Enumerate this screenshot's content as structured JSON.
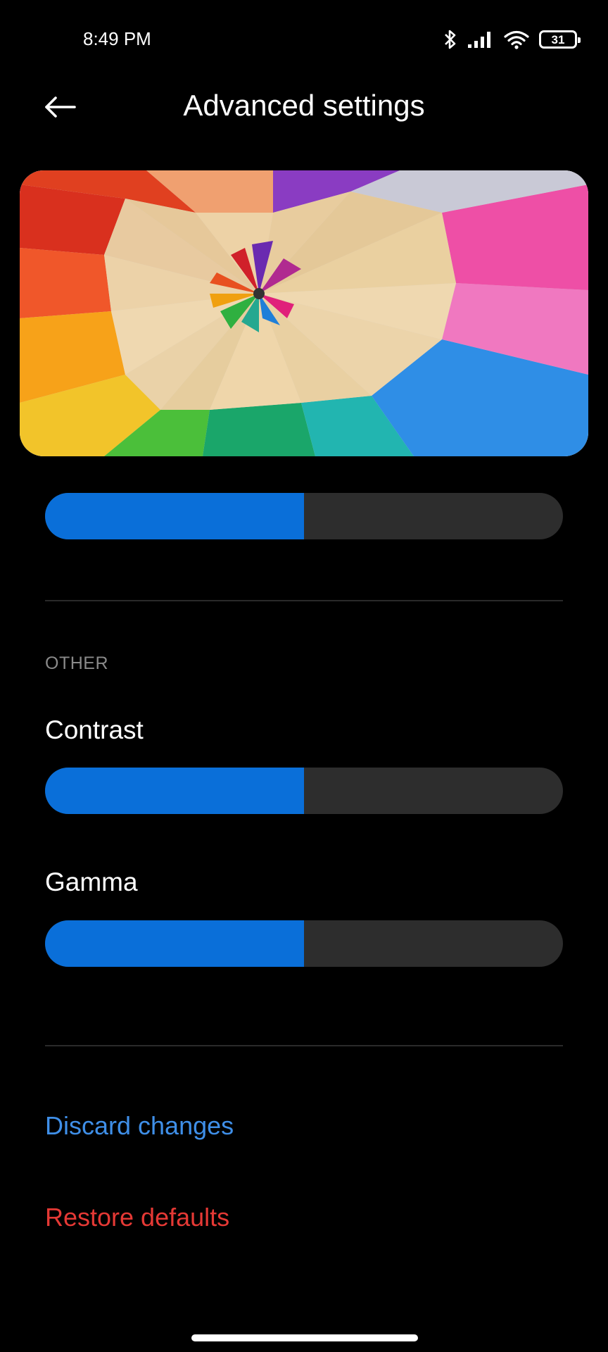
{
  "status_bar": {
    "time": "8:49 PM",
    "battery_level": "31",
    "icons": [
      "bluetooth-icon",
      "signal-icon",
      "wifi-icon",
      "battery-icon"
    ]
  },
  "header": {
    "title": "Advanced settings",
    "back_icon": "arrow-left-icon"
  },
  "preview": {
    "description_icon": "colored-pencils-image"
  },
  "sliders": {
    "top": {
      "level": 0.5
    },
    "contrast": {
      "label": "Contrast",
      "level": 0.5
    },
    "gamma": {
      "label": "Gamma",
      "level": 0.5
    }
  },
  "section": {
    "other_label": "OTHER"
  },
  "actions": {
    "discard_label": "Discard changes",
    "restore_label": "Restore defaults"
  },
  "colors": {
    "accent": "#0a6fd9",
    "track": "#2d2d2d",
    "link_blue": "#3f8fe8",
    "link_red": "#e53935",
    "background": "#000000"
  }
}
